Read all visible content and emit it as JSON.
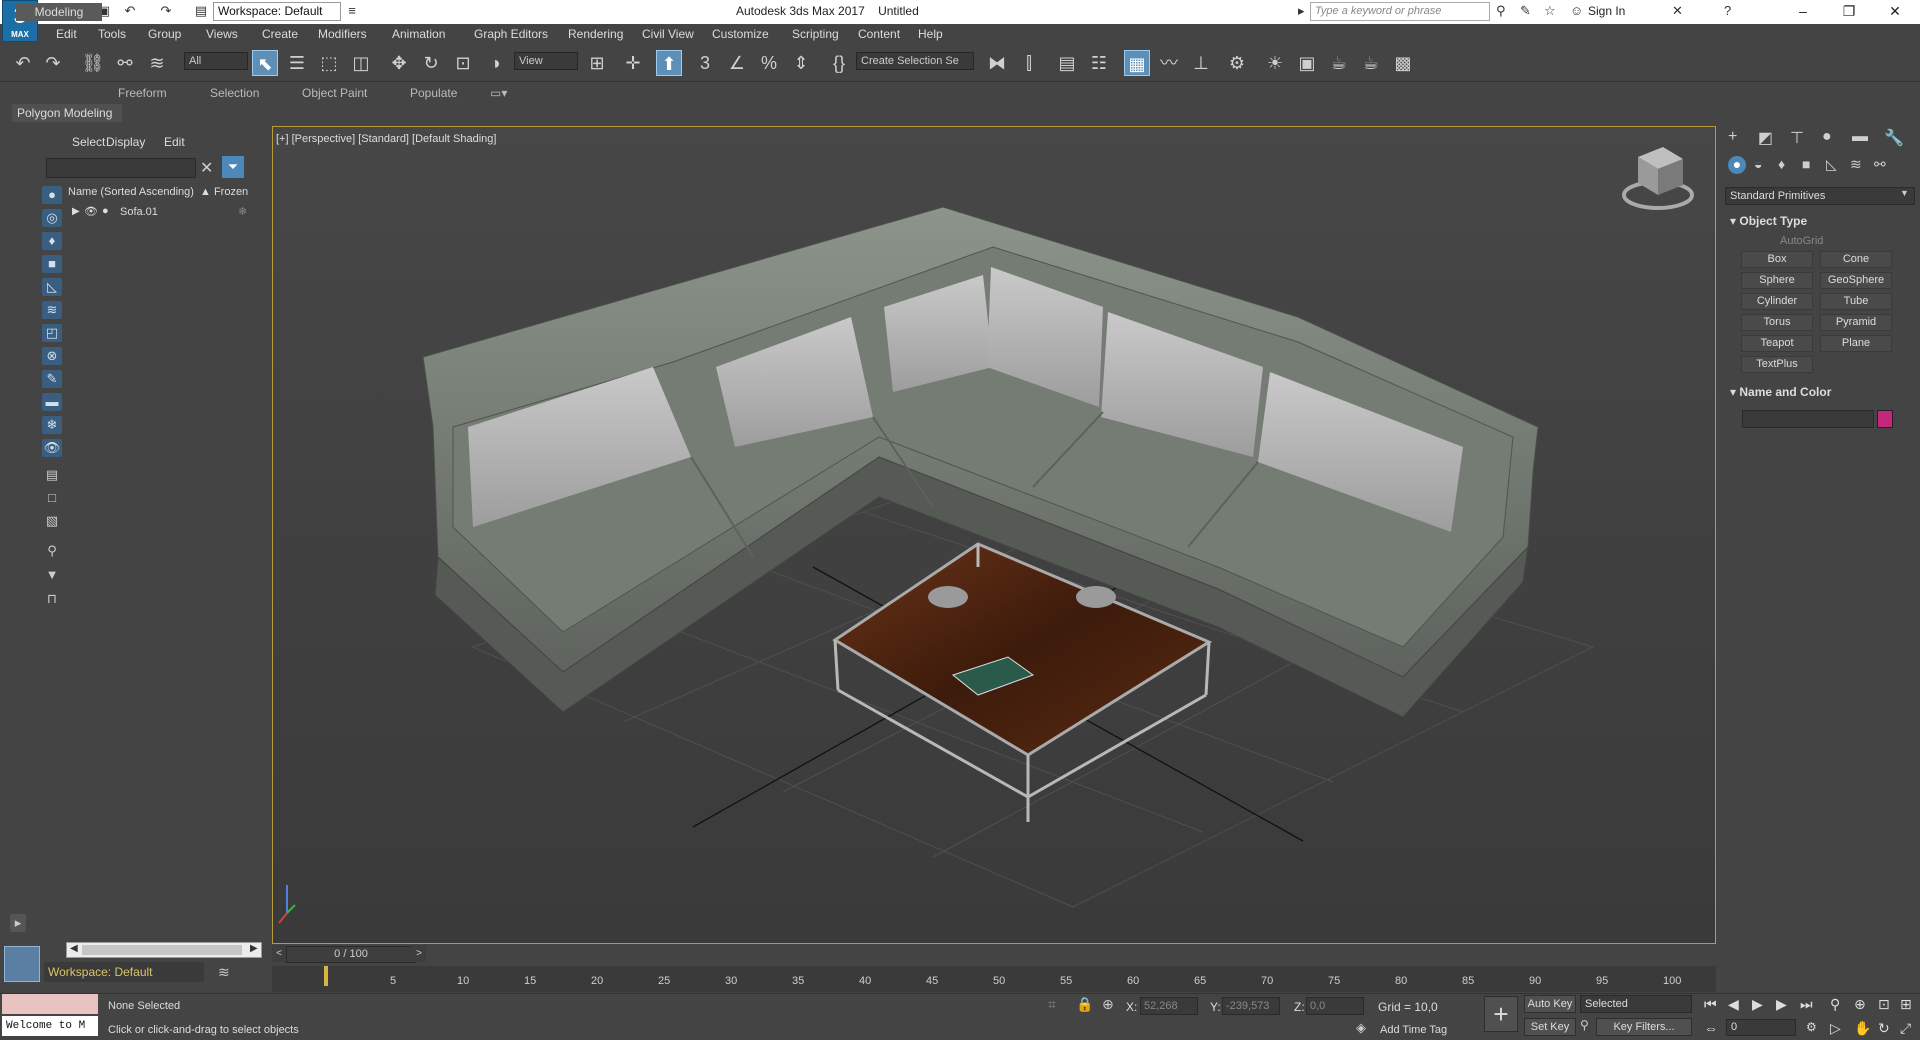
{
  "title_bar": {
    "app_title": "Autodesk 3ds Max 2017",
    "doc_title": "Untitled",
    "workspace": "Workspace: Default",
    "search_placeholder": "Type a keyword or phrase",
    "sign_in": "Sign In",
    "logo_text": "3",
    "logo_sub": "MAX"
  },
  "menus": [
    "Edit",
    "Tools",
    "Group",
    "Views",
    "Create",
    "Modifiers",
    "Animation",
    "Graph Editors",
    "Rendering",
    "Civil View",
    "Customize",
    "Scripting",
    "Content",
    "Help"
  ],
  "toolbar": {
    "filter_value": "All",
    "coord_value": "View",
    "selection_set": "Create Selection Se"
  },
  "ribbon": {
    "tabs": [
      "Modeling",
      "Freeform",
      "Selection",
      "Object Paint",
      "Populate"
    ],
    "active_tab": "Modeling",
    "panel_label": "Polygon Modeling"
  },
  "scene_explorer": {
    "tabs": [
      "Select",
      "Display",
      "Edit"
    ],
    "col_name": "Name (Sorted Ascending)",
    "col_frozen": "▲ Frozen",
    "items": [
      {
        "name": "Sofa.01"
      }
    ],
    "workspace": "Workspace: Default"
  },
  "viewport": {
    "label": "[+] [Perspective] [Standard] [Default Shading]"
  },
  "command_panel": {
    "category": "Standard Primitives",
    "object_type_title": "Object Type",
    "autogrid": "AutoGrid",
    "primitives": [
      "Box",
      "Cone",
      "Sphere",
      "GeoSphere",
      "Cylinder",
      "Tube",
      "Torus",
      "Pyramid",
      "Teapot",
      "Plane",
      "TextPlus"
    ],
    "name_color_title": "Name and Color",
    "object_color": "#c4287a"
  },
  "timeline": {
    "frame_display": "0 / 100",
    "ticks": [
      "5",
      "10",
      "15",
      "20",
      "25",
      "30",
      "35",
      "40",
      "45",
      "50",
      "55",
      "60",
      "65",
      "70",
      "75",
      "80",
      "85",
      "90",
      "95",
      "100"
    ]
  },
  "status": {
    "welcome": "Welcome to M",
    "selection": "None Selected",
    "hint": "Click or click-and-drag to select objects",
    "x_label": "X:",
    "x_value": "52,268",
    "y_label": "Y:",
    "y_value": "-239,573",
    "z_label": "Z:",
    "z_value": "0,0",
    "grid": "Grid = 10,0",
    "add_time_tag": "Add Time Tag",
    "auto_key": "Auto Key",
    "set_key": "Set Key",
    "selected_mode": "Selected",
    "key_filters": "Key Filters...",
    "current_frame": "0"
  }
}
